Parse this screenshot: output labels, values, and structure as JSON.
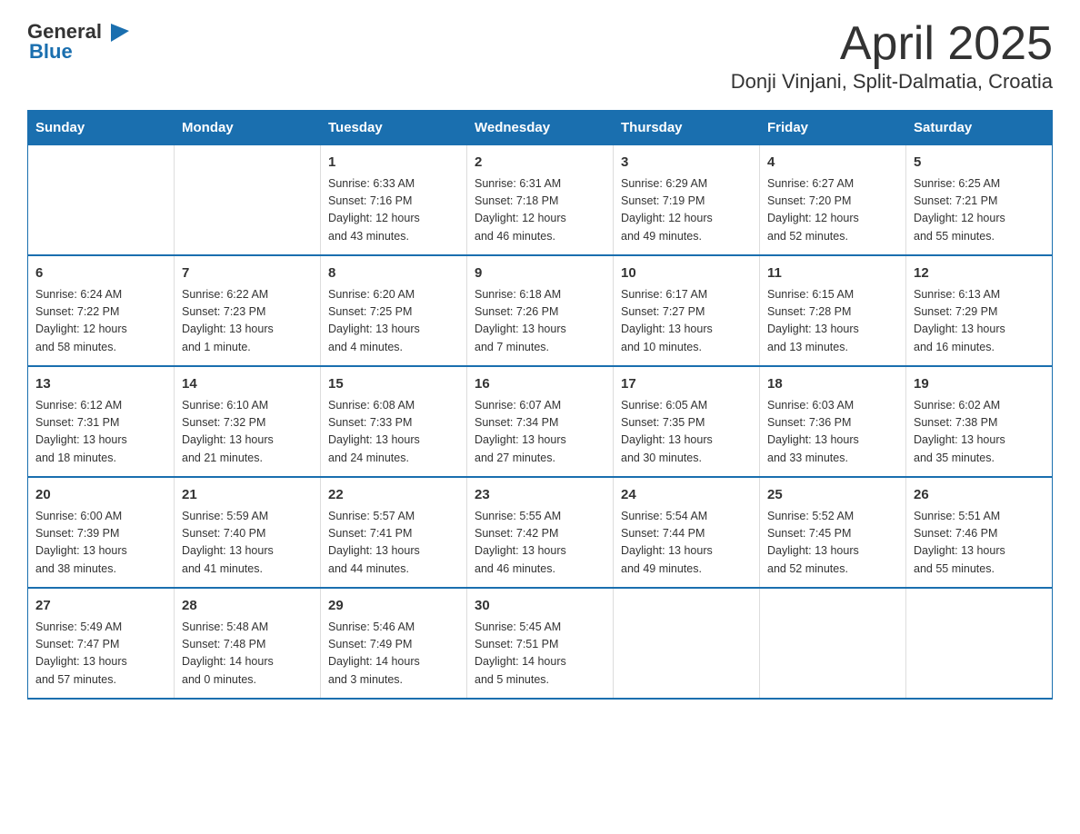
{
  "header": {
    "logo_general": "General",
    "logo_blue": "Blue",
    "month_year": "April 2025",
    "location": "Donji Vinjani, Split-Dalmatia, Croatia"
  },
  "days_of_week": [
    "Sunday",
    "Monday",
    "Tuesday",
    "Wednesday",
    "Thursday",
    "Friday",
    "Saturday"
  ],
  "weeks": [
    [
      {
        "day": "",
        "info": ""
      },
      {
        "day": "",
        "info": ""
      },
      {
        "day": "1",
        "info": "Sunrise: 6:33 AM\nSunset: 7:16 PM\nDaylight: 12 hours\nand 43 minutes."
      },
      {
        "day": "2",
        "info": "Sunrise: 6:31 AM\nSunset: 7:18 PM\nDaylight: 12 hours\nand 46 minutes."
      },
      {
        "day": "3",
        "info": "Sunrise: 6:29 AM\nSunset: 7:19 PM\nDaylight: 12 hours\nand 49 minutes."
      },
      {
        "day": "4",
        "info": "Sunrise: 6:27 AM\nSunset: 7:20 PM\nDaylight: 12 hours\nand 52 minutes."
      },
      {
        "day": "5",
        "info": "Sunrise: 6:25 AM\nSunset: 7:21 PM\nDaylight: 12 hours\nand 55 minutes."
      }
    ],
    [
      {
        "day": "6",
        "info": "Sunrise: 6:24 AM\nSunset: 7:22 PM\nDaylight: 12 hours\nand 58 minutes."
      },
      {
        "day": "7",
        "info": "Sunrise: 6:22 AM\nSunset: 7:23 PM\nDaylight: 13 hours\nand 1 minute."
      },
      {
        "day": "8",
        "info": "Sunrise: 6:20 AM\nSunset: 7:25 PM\nDaylight: 13 hours\nand 4 minutes."
      },
      {
        "day": "9",
        "info": "Sunrise: 6:18 AM\nSunset: 7:26 PM\nDaylight: 13 hours\nand 7 minutes."
      },
      {
        "day": "10",
        "info": "Sunrise: 6:17 AM\nSunset: 7:27 PM\nDaylight: 13 hours\nand 10 minutes."
      },
      {
        "day": "11",
        "info": "Sunrise: 6:15 AM\nSunset: 7:28 PM\nDaylight: 13 hours\nand 13 minutes."
      },
      {
        "day": "12",
        "info": "Sunrise: 6:13 AM\nSunset: 7:29 PM\nDaylight: 13 hours\nand 16 minutes."
      }
    ],
    [
      {
        "day": "13",
        "info": "Sunrise: 6:12 AM\nSunset: 7:31 PM\nDaylight: 13 hours\nand 18 minutes."
      },
      {
        "day": "14",
        "info": "Sunrise: 6:10 AM\nSunset: 7:32 PM\nDaylight: 13 hours\nand 21 minutes."
      },
      {
        "day": "15",
        "info": "Sunrise: 6:08 AM\nSunset: 7:33 PM\nDaylight: 13 hours\nand 24 minutes."
      },
      {
        "day": "16",
        "info": "Sunrise: 6:07 AM\nSunset: 7:34 PM\nDaylight: 13 hours\nand 27 minutes."
      },
      {
        "day": "17",
        "info": "Sunrise: 6:05 AM\nSunset: 7:35 PM\nDaylight: 13 hours\nand 30 minutes."
      },
      {
        "day": "18",
        "info": "Sunrise: 6:03 AM\nSunset: 7:36 PM\nDaylight: 13 hours\nand 33 minutes."
      },
      {
        "day": "19",
        "info": "Sunrise: 6:02 AM\nSunset: 7:38 PM\nDaylight: 13 hours\nand 35 minutes."
      }
    ],
    [
      {
        "day": "20",
        "info": "Sunrise: 6:00 AM\nSunset: 7:39 PM\nDaylight: 13 hours\nand 38 minutes."
      },
      {
        "day": "21",
        "info": "Sunrise: 5:59 AM\nSunset: 7:40 PM\nDaylight: 13 hours\nand 41 minutes."
      },
      {
        "day": "22",
        "info": "Sunrise: 5:57 AM\nSunset: 7:41 PM\nDaylight: 13 hours\nand 44 minutes."
      },
      {
        "day": "23",
        "info": "Sunrise: 5:55 AM\nSunset: 7:42 PM\nDaylight: 13 hours\nand 46 minutes."
      },
      {
        "day": "24",
        "info": "Sunrise: 5:54 AM\nSunset: 7:44 PM\nDaylight: 13 hours\nand 49 minutes."
      },
      {
        "day": "25",
        "info": "Sunrise: 5:52 AM\nSunset: 7:45 PM\nDaylight: 13 hours\nand 52 minutes."
      },
      {
        "day": "26",
        "info": "Sunrise: 5:51 AM\nSunset: 7:46 PM\nDaylight: 13 hours\nand 55 minutes."
      }
    ],
    [
      {
        "day": "27",
        "info": "Sunrise: 5:49 AM\nSunset: 7:47 PM\nDaylight: 13 hours\nand 57 minutes."
      },
      {
        "day": "28",
        "info": "Sunrise: 5:48 AM\nSunset: 7:48 PM\nDaylight: 14 hours\nand 0 minutes."
      },
      {
        "day": "29",
        "info": "Sunrise: 5:46 AM\nSunset: 7:49 PM\nDaylight: 14 hours\nand 3 minutes."
      },
      {
        "day": "30",
        "info": "Sunrise: 5:45 AM\nSunset: 7:51 PM\nDaylight: 14 hours\nand 5 minutes."
      },
      {
        "day": "",
        "info": ""
      },
      {
        "day": "",
        "info": ""
      },
      {
        "day": "",
        "info": ""
      }
    ]
  ]
}
